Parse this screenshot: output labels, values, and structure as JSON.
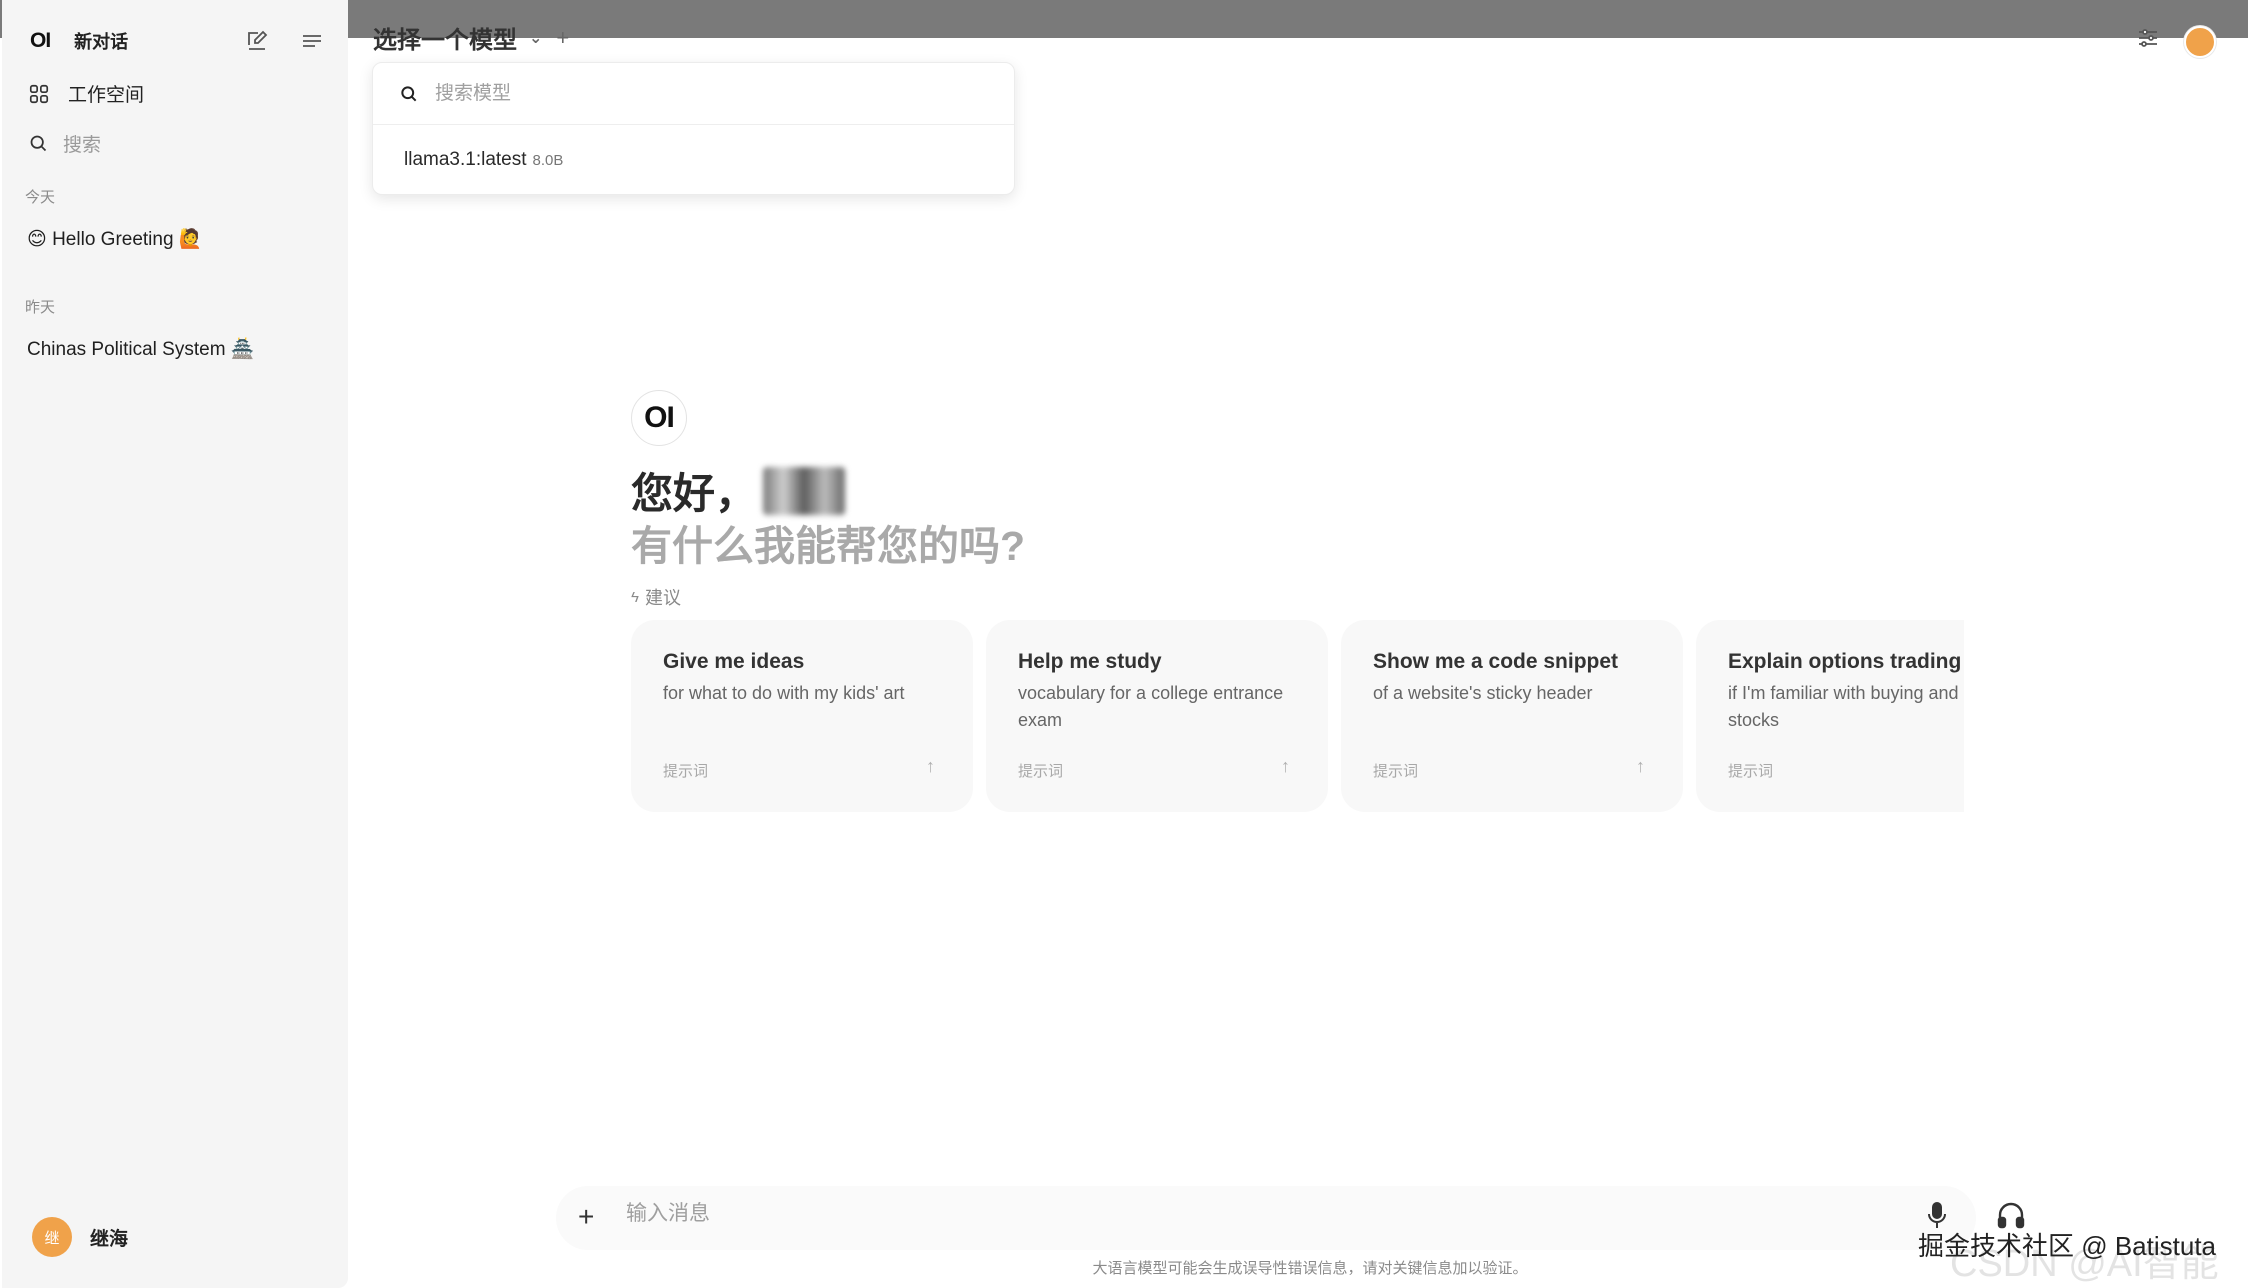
{
  "sidebar": {
    "logo": "OI",
    "new_chat": "新对话",
    "workspace": "工作空间",
    "search_placeholder": "搜索",
    "sections": [
      {
        "label": "今天",
        "chats": [
          "😊 Hello Greeting 🙋"
        ]
      },
      {
        "label": "昨天",
        "chats": [
          "Chinas Political System 🏯"
        ]
      }
    ],
    "user": {
      "avatar_char": "继",
      "name": "继海"
    }
  },
  "header": {
    "model_select_label": "选择一个模型",
    "model_dropdown": {
      "search_placeholder": "搜索模型",
      "items": [
        {
          "name": "llama3.1:latest",
          "size": "8.0B"
        }
      ]
    }
  },
  "welcome": {
    "logo": "OI",
    "greeting": "您好，",
    "subtitle": "有什么我能帮您的吗?",
    "suggestions_label": "建议",
    "suggestions": [
      {
        "title": "Give me ideas",
        "subtitle": "for what to do with my kids' art",
        "tag": "提示词"
      },
      {
        "title": "Help me study",
        "subtitle": "vocabulary for a college entrance exam",
        "tag": "提示词"
      },
      {
        "title": "Show me a code snippet",
        "subtitle": "of a website's sticky header",
        "tag": "提示词"
      },
      {
        "title": "Explain options trading",
        "subtitle": "if I'm familiar with buying and selling stocks",
        "tag": "提示词"
      }
    ]
  },
  "composer": {
    "placeholder": "输入消息",
    "disclaimer": "大语言模型可能会生成误导性错误信息，请对关键信息加以验证。"
  },
  "watermark": {
    "text": "掘金技术社区 @ Batistuta",
    "text2": "CSDN @AI智能"
  },
  "colors": {
    "accent_avatar": "#f0a24a",
    "sidebar_bg": "#f5f5f5",
    "card_bg": "#f8f8f8"
  }
}
